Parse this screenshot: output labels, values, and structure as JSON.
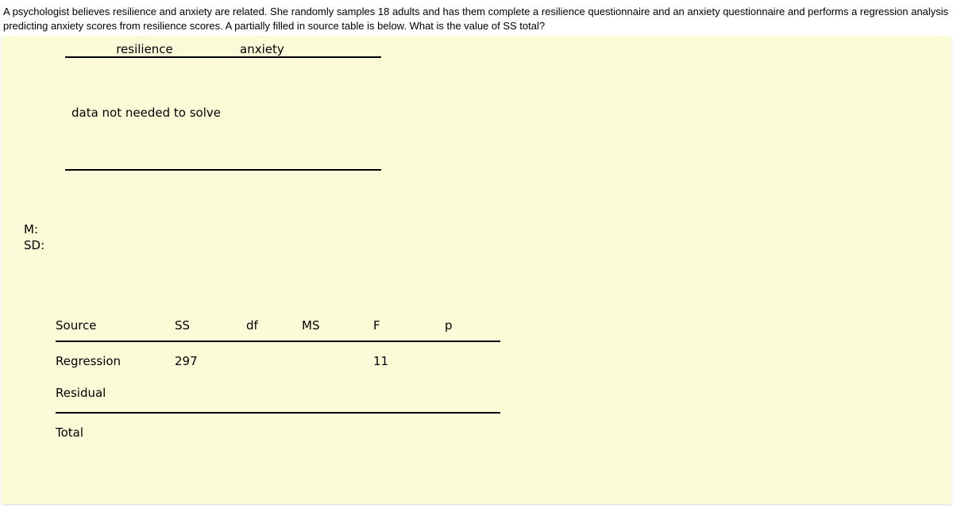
{
  "question_text": "A psychologist believes resilience and anxiety are related. She randomly samples 18 adults and has them complete a resilience questionnaire and an anxiety questionnaire and performs a regression analysis predicting anxiety scores from resilience scores. A partially filled in source table is below. What is the value of SS total?",
  "data_table": {
    "col1_header": "resilience",
    "col2_header": "anxiety",
    "note": "data not needed to solve"
  },
  "stats": {
    "mean_label": "M:",
    "sd_label": "SD:"
  },
  "source_table": {
    "headers": {
      "source": "Source",
      "ss": "SS",
      "df": "df",
      "ms": "MS",
      "f": "F",
      "p": "p"
    },
    "rows": {
      "regression": {
        "label": "Regression",
        "ss": "297",
        "df": "",
        "ms": "",
        "f": "11",
        "p": ""
      },
      "residual": {
        "label": "Residual",
        "ss": "",
        "df": "",
        "ms": "",
        "f": "",
        "p": ""
      },
      "total": {
        "label": "Total",
        "ss": "",
        "df": "",
        "ms": "",
        "f": "",
        "p": ""
      }
    }
  }
}
